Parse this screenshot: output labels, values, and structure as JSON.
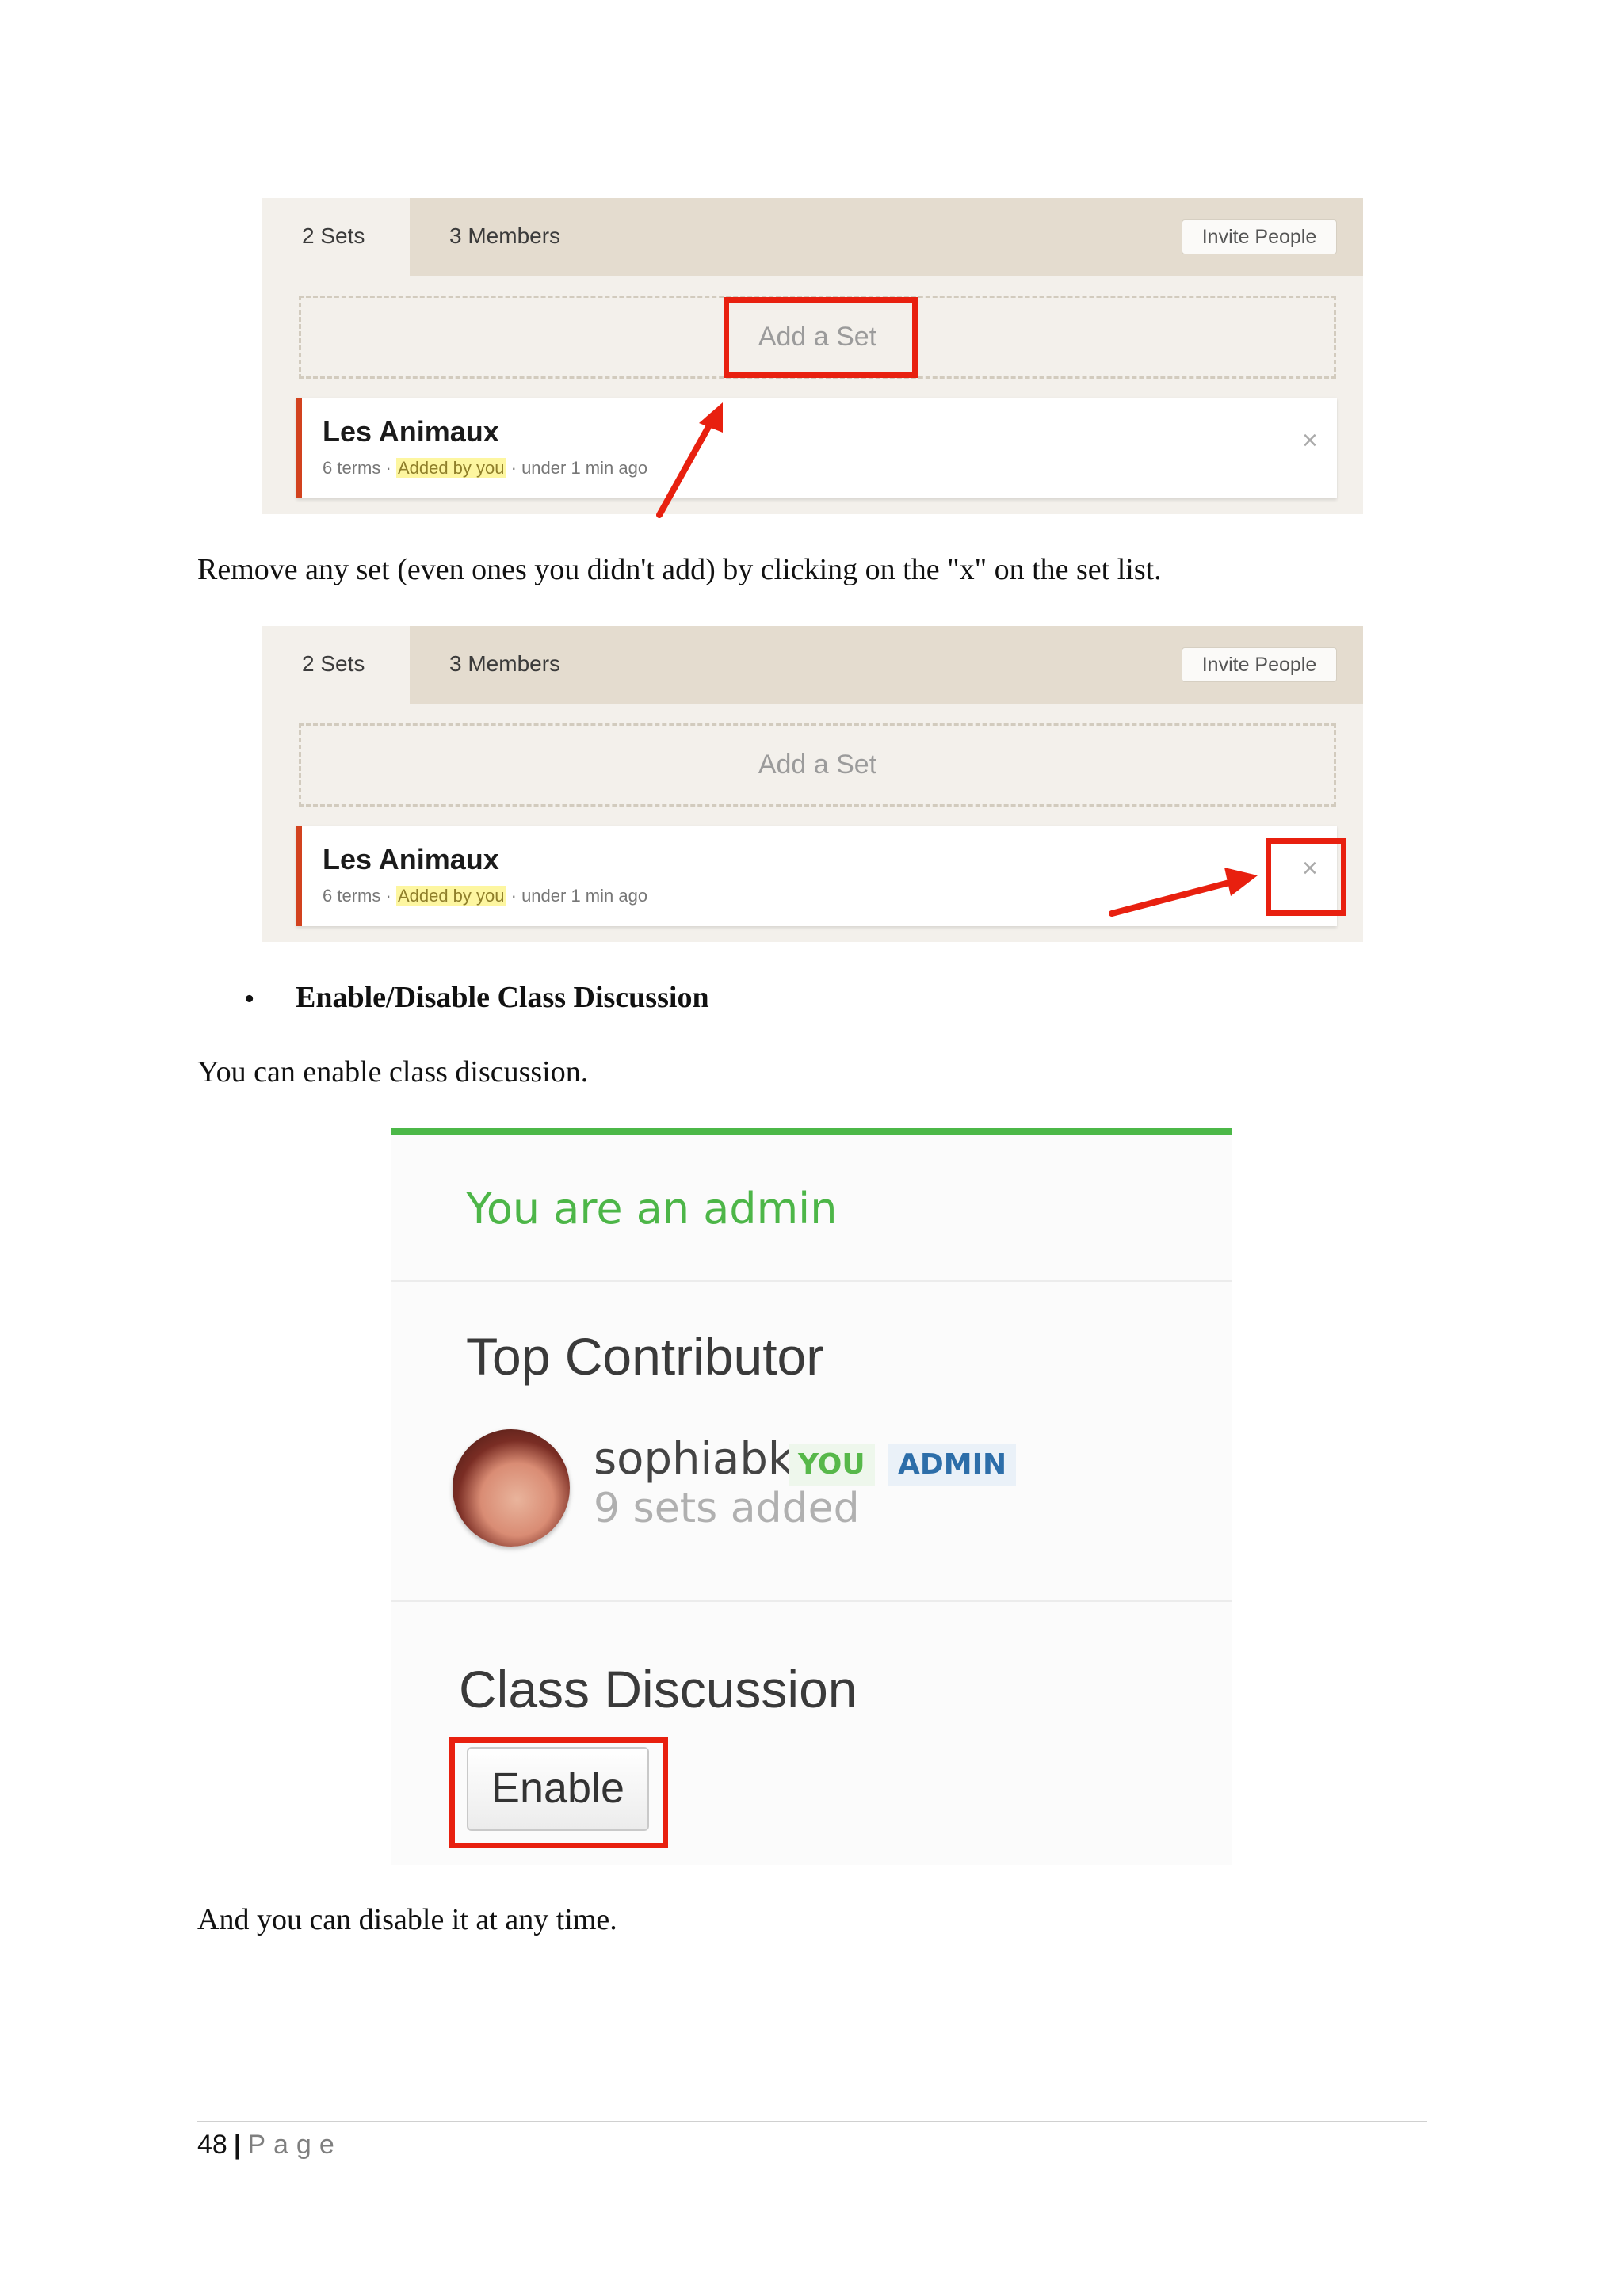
{
  "panel": {
    "tab_sets": "2 Sets",
    "tab_members": "3 Members",
    "invite_label": "Invite People",
    "add_set_label": "Add a Set",
    "set_title": "Les Animaux",
    "set_terms": "6 terms",
    "set_added_by": "Added by you",
    "set_time": "under 1 min ago",
    "meta_separator": "·",
    "remove_glyph": "×"
  },
  "text": {
    "remove_instruction": "Remove any set (even ones you didn't add) by clicking on the \"x\" on the set list.",
    "bullet_heading": "Enable/Disable Class Discussion",
    "enable_intro": "You can enable class discussion.",
    "disable_note": "And you can disable it at any time."
  },
  "admin_panel": {
    "status": "You are an admin",
    "top_contributor_heading": "Top Contributor",
    "username": "sophiabk",
    "badge_you": "YOU",
    "badge_admin": "ADMIN",
    "sets_added": "9 sets added",
    "discussion_heading": "Class Discussion",
    "enable_label": "Enable"
  },
  "footer": {
    "page_number": "48",
    "separator": "|",
    "page_word": "Page"
  },
  "colors": {
    "highlight_red": "#e8200f",
    "admin_green": "#4cb848",
    "set_accent": "#d2421e"
  }
}
